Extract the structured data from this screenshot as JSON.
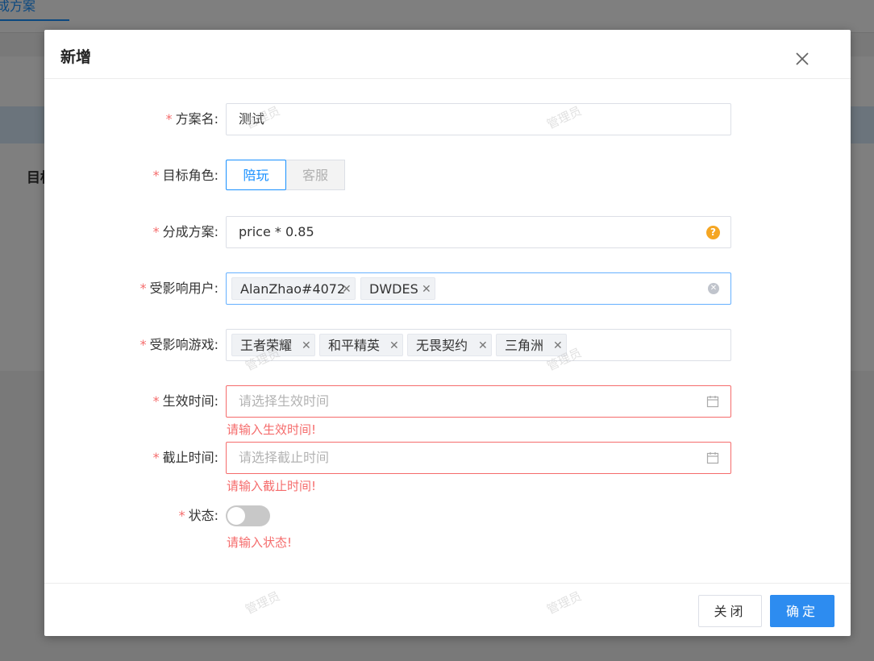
{
  "background": {
    "tab_label": "成方案",
    "section_title": "目标"
  },
  "dialog": {
    "title": "新增",
    "form": {
      "plan_name": {
        "label": "方案名",
        "value": "测试"
      },
      "target_role": {
        "label": "目标角色",
        "options": [
          "陪玩",
          "客服"
        ],
        "selected": "陪玩"
      },
      "split_plan": {
        "label": "分成方案",
        "value": "price * 0.85",
        "help_icon": "?"
      },
      "affected_users": {
        "label": "受影响用户",
        "tags": [
          "AlanZhao#4072",
          "DWDES"
        ]
      },
      "affected_games": {
        "label": "受影响游戏",
        "tags": [
          "王者荣耀",
          "和平精英",
          "无畏契约",
          "三角洲"
        ]
      },
      "effective_time": {
        "label": "生效时间",
        "placeholder": "请选择生效时间",
        "error": "请输入生效时间!"
      },
      "deadline_time": {
        "label": "截止时间",
        "placeholder": "请选择截止时间",
        "error": "请输入截止时间!"
      },
      "status": {
        "label": "状态",
        "error": "请输入状态!"
      }
    },
    "footer": {
      "close_label": "关闭",
      "confirm_label": "确定"
    },
    "watermark": "管理员"
  },
  "colors": {
    "primary": "#1890ff",
    "error": "#f56c6c",
    "help": "#f5a623"
  },
  "icons": {
    "close": "close-icon",
    "help": "question-circle-icon",
    "clear": "clear-circle-icon",
    "calendar": "calendar-icon",
    "tag_close": "tag-close-icon"
  }
}
